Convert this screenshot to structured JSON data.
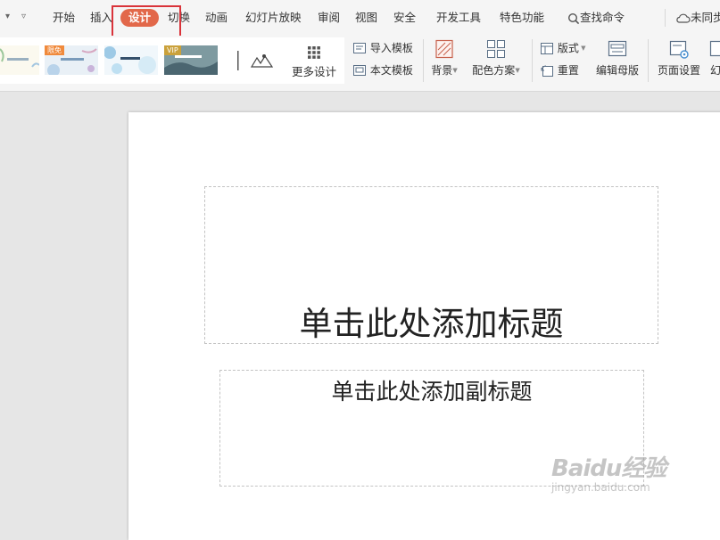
{
  "quick_access": {
    "dropdown_glyph": "▾",
    "customize_glyph": "▿"
  },
  "menu": {
    "tabs": [
      {
        "label": "开始"
      },
      {
        "label": "插入"
      },
      {
        "label": "设计"
      },
      {
        "label": "切换"
      },
      {
        "label": "动画"
      },
      {
        "label": "幻灯片放映"
      },
      {
        "label": "审阅"
      },
      {
        "label": "视图"
      },
      {
        "label": "安全"
      },
      {
        "label": "开发工具"
      },
      {
        "label": "特色功能"
      }
    ],
    "active_tab": "设计",
    "search_label": "查找命令",
    "sync_label": "未同步"
  },
  "ribbon": {
    "gallery": {
      "badge_free": "限免",
      "badge_vip": "VIP",
      "more_designs": "更多设计"
    },
    "import_template": "导入模板",
    "body_template": "本文模板",
    "background": "背景",
    "color_scheme": "配色方案",
    "layout": "版式",
    "reset": "重置",
    "edit_master": "编辑母版",
    "page_setup": "页面设置",
    "truncated_label": "幻"
  },
  "slide": {
    "title_placeholder": "单击此处添加标题",
    "subtitle_placeholder": "单击此处添加副标题"
  },
  "watermark": {
    "text": "Baidu经验",
    "url": "jingyan.baidu.com"
  },
  "colors": {
    "accent": "#e2684a",
    "highlight_box": "#d9333a",
    "workspace": "#e6e6e6"
  }
}
